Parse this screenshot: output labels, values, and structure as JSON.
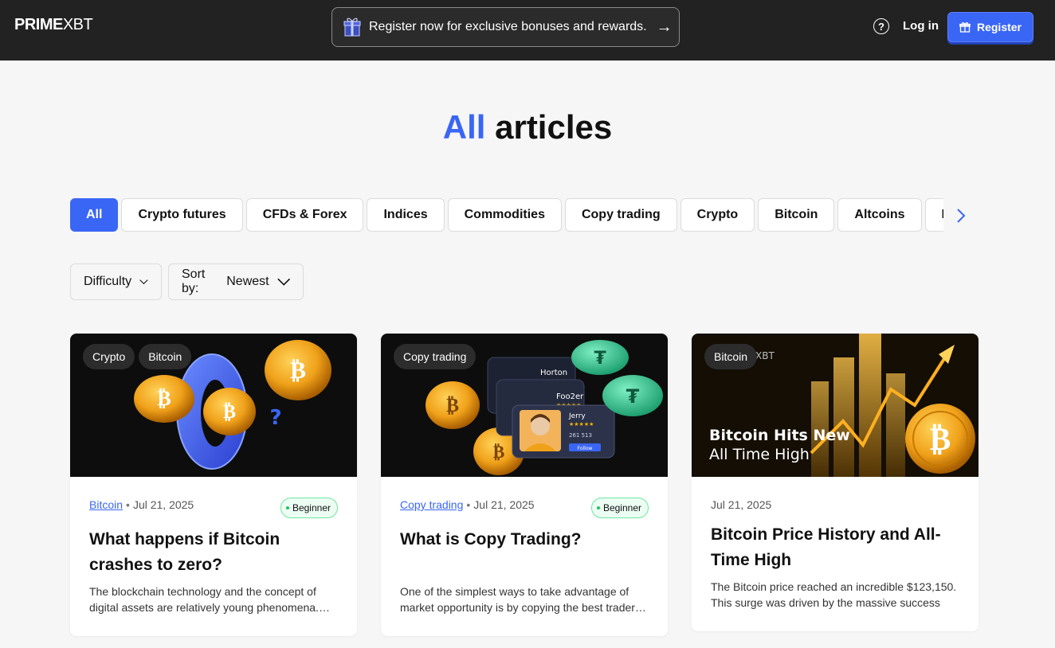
{
  "header": {
    "logo_main": "PRIME",
    "logo_suffix": "XBT",
    "banner_text": "Register now for exclusive bonuses and rewards.",
    "banner_arrow": "→",
    "help_symbol": "?",
    "login_label": "Log in",
    "register_label": "Register"
  },
  "page": {
    "title_accent": "All",
    "title_rest": "articles"
  },
  "tabs": [
    {
      "label": "All",
      "active": true
    },
    {
      "label": "Crypto futures"
    },
    {
      "label": "CFDs & Forex"
    },
    {
      "label": "Indices"
    },
    {
      "label": "Commodities"
    },
    {
      "label": "Copy trading"
    },
    {
      "label": "Crypto"
    },
    {
      "label": "Bitcoin"
    },
    {
      "label": "Altcoins"
    },
    {
      "label": "DeFi"
    }
  ],
  "filters": {
    "difficulty_label": "Difficulty",
    "sort_prefix": "Sort by:",
    "sort_value": "Newest"
  },
  "cards": [
    {
      "tags": [
        "Crypto",
        "Bitcoin"
      ],
      "category": "Bitcoin",
      "separator": "•",
      "date": "Jul 21, 2025",
      "level": "Beginner",
      "title": "What happens if Bitcoin crashes to zero?",
      "excerpt": "The blockchain technology and the concept of digital assets are relatively young phenomena.…"
    },
    {
      "tags": [
        "Copy trading"
      ],
      "category": "Copy trading",
      "separator": "•",
      "date": "Jul 21, 2025",
      "level": "Beginner",
      "title": "What is Copy Trading?",
      "excerpt": "One of the simplest ways to take advantage of market opportunity is by copying the best trader…",
      "image_text": {
        "trader1": "Horton",
        "trader2": "Foo2er",
        "trader3": "Jerry",
        "stats": "261  513",
        "follow": "Follow"
      }
    },
    {
      "tags": [
        "Bitcoin"
      ],
      "date": "Jul 21, 2025",
      "title": "Bitcoin Price History and All-Time High",
      "excerpt": "The Bitcoin price reached an incredible $123,150. This surge was driven by the massive success o…",
      "image_text": {
        "line1": "Bitcoin Hits New",
        "line2": "All Time High",
        "brand": "XBT"
      }
    }
  ],
  "colors": {
    "accent": "#3a66f5",
    "header_bg": "#222222",
    "page_bg": "#f6f6f6",
    "level_border": "#6ee7a0"
  }
}
